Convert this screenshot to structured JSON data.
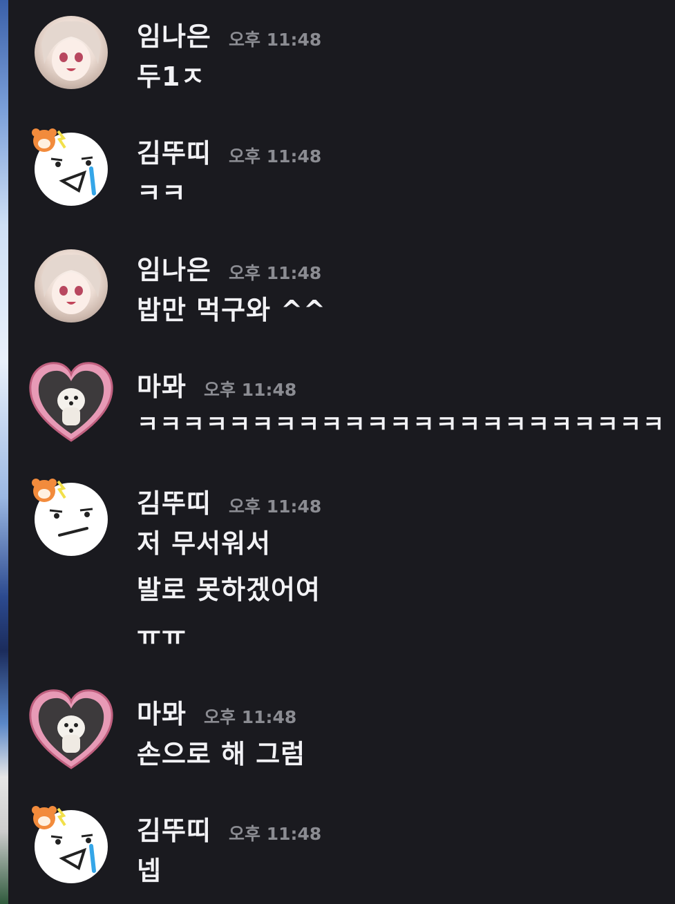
{
  "messages": [
    {
      "user": "임나은",
      "time": "오후 11:48",
      "avatar": "girl-avatar",
      "lines": [
        "두1ㅈ"
      ]
    },
    {
      "user": "김뚜띠",
      "time": "오후 11:48",
      "avatar": "crying-face-avatar",
      "lines": [
        "ㅋㅋ"
      ]
    },
    {
      "user": "임나은",
      "time": "오후 11:48",
      "avatar": "girl-avatar",
      "lines": [
        "밥만 먹구와 ^^"
      ]
    },
    {
      "user": "마뫄",
      "time": "오후 11:48",
      "avatar": "heart-dog-avatar",
      "lines": [
        "ㅋㅋㅋㅋㅋㅋㅋㅋㅋㅋㅋㅋㅋㅋㅋㅋㅋㅋㅋㅋㅋㅋㅋ"
      ]
    },
    {
      "user": "김뚜띠",
      "time": "오후 11:48",
      "avatar": "neutral-face-avatar",
      "lines": [
        "저 무서워서",
        "발로 못하겠어여",
        "ㅠㅠ"
      ]
    },
    {
      "user": "마뫄",
      "time": "오후 11:48",
      "avatar": "heart-dog-avatar",
      "lines": [
        "손으로 해 그럼"
      ]
    },
    {
      "user": "김뚜띠",
      "time": "오후 11:48",
      "avatar": "crying-face-avatar",
      "lines": [
        "넵"
      ]
    }
  ],
  "colors": {
    "background": "#1a1a1f",
    "text": "#f2f2f5",
    "timestamp": "#8b8c92"
  }
}
